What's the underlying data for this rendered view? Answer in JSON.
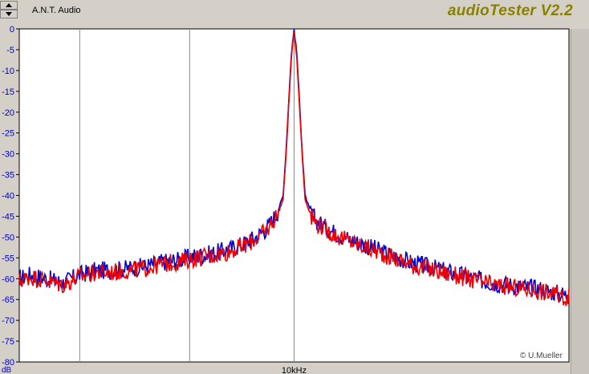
{
  "window": {
    "title": "A.N.T. Audio",
    "brand": "audioTester V2.2",
    "credit": "© U.Mueller"
  },
  "chart_data": {
    "type": "line",
    "title": "",
    "xlabel": "10kHz",
    "ylabel": "dB",
    "ylim": [
      -80,
      0
    ],
    "yticks": [
      "0",
      "-5",
      "-10",
      "-15",
      "-20",
      "-25",
      "-30",
      "-35",
      "-40",
      "-45",
      "-50",
      "-55",
      "-60",
      "-65",
      "-70",
      "-75",
      "-80"
    ],
    "xlim": [
      0,
      1
    ],
    "grid": true,
    "colors": {
      "series_blue": "#0000d0",
      "series_red": "#ee0000",
      "axis_text": "#0000c0",
      "grid": "#8a8a8a"
    },
    "series": [
      {
        "color": "#0000d0",
        "x": [
          0.0,
          0.02,
          0.05,
          0.08,
          0.11,
          0.14,
          0.17,
          0.2,
          0.23,
          0.26,
          0.29,
          0.32,
          0.35,
          0.38,
          0.41,
          0.43,
          0.45,
          0.46,
          0.47,
          0.48,
          0.485,
          0.49,
          0.495,
          0.5,
          0.505,
          0.51,
          0.515,
          0.52,
          0.53,
          0.54,
          0.56,
          0.59,
          0.62,
          0.65,
          0.68,
          0.71,
          0.74,
          0.77,
          0.8,
          0.83,
          0.86,
          0.89,
          0.92,
          0.95,
          0.98,
          1.0
        ],
        "y": [
          -60,
          -59,
          -60,
          -61,
          -59,
          -58,
          -58,
          -57.5,
          -57,
          -56,
          -55.5,
          -54.5,
          -54,
          -53,
          -51.5,
          -50,
          -48,
          -46,
          -44,
          -40,
          -30,
          -18,
          -6,
          0,
          -6,
          -18,
          -30,
          -40,
          -44,
          -46,
          -48,
          -50,
          -51.5,
          -53,
          -54.5,
          -56,
          -57,
          -58,
          -59,
          -60,
          -61,
          -61.5,
          -62,
          -62.5,
          -63.5,
          -64
        ]
      },
      {
        "color": "#ee0000",
        "x": [
          0.0,
          0.02,
          0.05,
          0.08,
          0.11,
          0.14,
          0.17,
          0.2,
          0.23,
          0.26,
          0.29,
          0.32,
          0.35,
          0.38,
          0.41,
          0.43,
          0.45,
          0.46,
          0.47,
          0.48,
          0.485,
          0.49,
          0.495,
          0.5,
          0.505,
          0.51,
          0.515,
          0.52,
          0.53,
          0.54,
          0.56,
          0.59,
          0.62,
          0.65,
          0.68,
          0.71,
          0.74,
          0.77,
          0.8,
          0.83,
          0.86,
          0.89,
          0.92,
          0.95,
          0.98,
          1.0
        ],
        "y": [
          -60.5,
          -59.5,
          -60.5,
          -61.5,
          -59.5,
          -58.5,
          -58.5,
          -58,
          -57.5,
          -56.5,
          -56,
          -55,
          -54.5,
          -53.5,
          -52,
          -50.5,
          -48.5,
          -46.5,
          -44.5,
          -41,
          -31,
          -19,
          -7,
          -0.5,
          -7,
          -19,
          -31,
          -41,
          -44.5,
          -46.5,
          -48.5,
          -50.5,
          -52,
          -53.5,
          -55,
          -56.5,
          -57.5,
          -58.5,
          -59.5,
          -60.5,
          -61.5,
          -62,
          -62.5,
          -63,
          -64,
          -64.5
        ]
      }
    ]
  }
}
